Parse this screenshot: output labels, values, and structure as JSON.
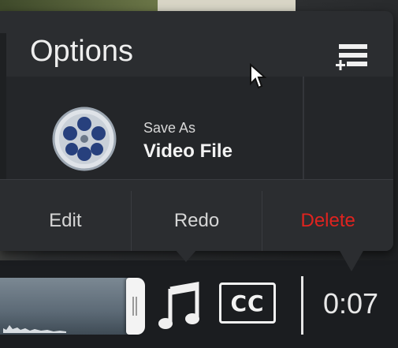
{
  "options_popup": {
    "title": "Options",
    "save": {
      "label": "Save As",
      "value": "Video File"
    },
    "actions": {
      "edit": "Edit",
      "redo": "Redo",
      "delete": "Delete"
    }
  },
  "toolbar": {
    "cc_label": "CC",
    "time": "0:07"
  },
  "icons": {
    "menu": "menu-add-icon",
    "film": "film-reel-icon",
    "music": "music-note-icon",
    "cursor": "mouse-cursor-icon"
  },
  "colors": {
    "popup_bg": "#2b2d30",
    "delete_color": "#e0231f",
    "text": "#eeeeee"
  }
}
